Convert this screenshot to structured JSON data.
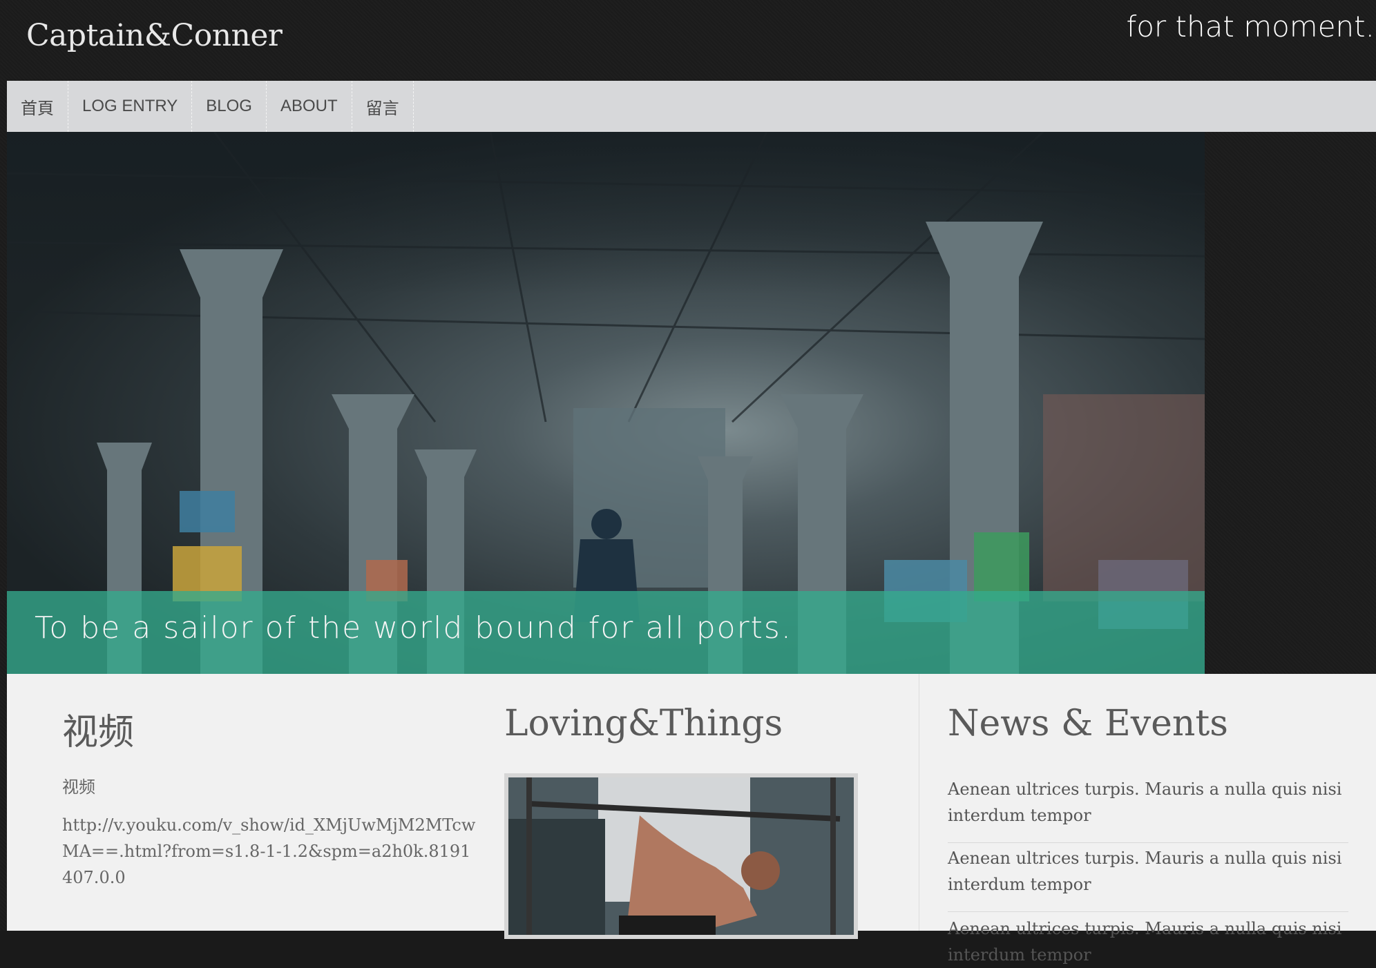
{
  "header": {
    "logo": "Captain&Conner",
    "tagline": "for that moment."
  },
  "nav": {
    "items": [
      {
        "label": "首頁"
      },
      {
        "label": "LOG ENTRY"
      },
      {
        "label": "BLOG"
      },
      {
        "label": "ABOUT"
      },
      {
        "label": "留言"
      }
    ]
  },
  "hero": {
    "caption": "To be a sailor of the world bound for all ports."
  },
  "video_section": {
    "title": "视频",
    "label": "视频",
    "url": "http://v.youku.com/v_show/id_XMjUwMjM2MTcwMA==.html?from=s1.8-1-1.2&spm=a2h0k.8191407.0.0"
  },
  "loving_section": {
    "title": "Loving&Things"
  },
  "news_section": {
    "title": "News & Events",
    "items": [
      "Aenean ultrices turpis. Mauris a nulla quis nisi interdum tempor",
      "Aenean ultrices turpis. Mauris a nulla quis nisi interdum tempor",
      "Aenean ultrices turpis. Mauris a nulla quis nisi interdum tempor"
    ]
  },
  "colors": {
    "background": "#1b1b1b",
    "nav_background": "#d7d8da",
    "caption_overlay": "#35aa8d",
    "content_background": "#f1f1f1"
  }
}
